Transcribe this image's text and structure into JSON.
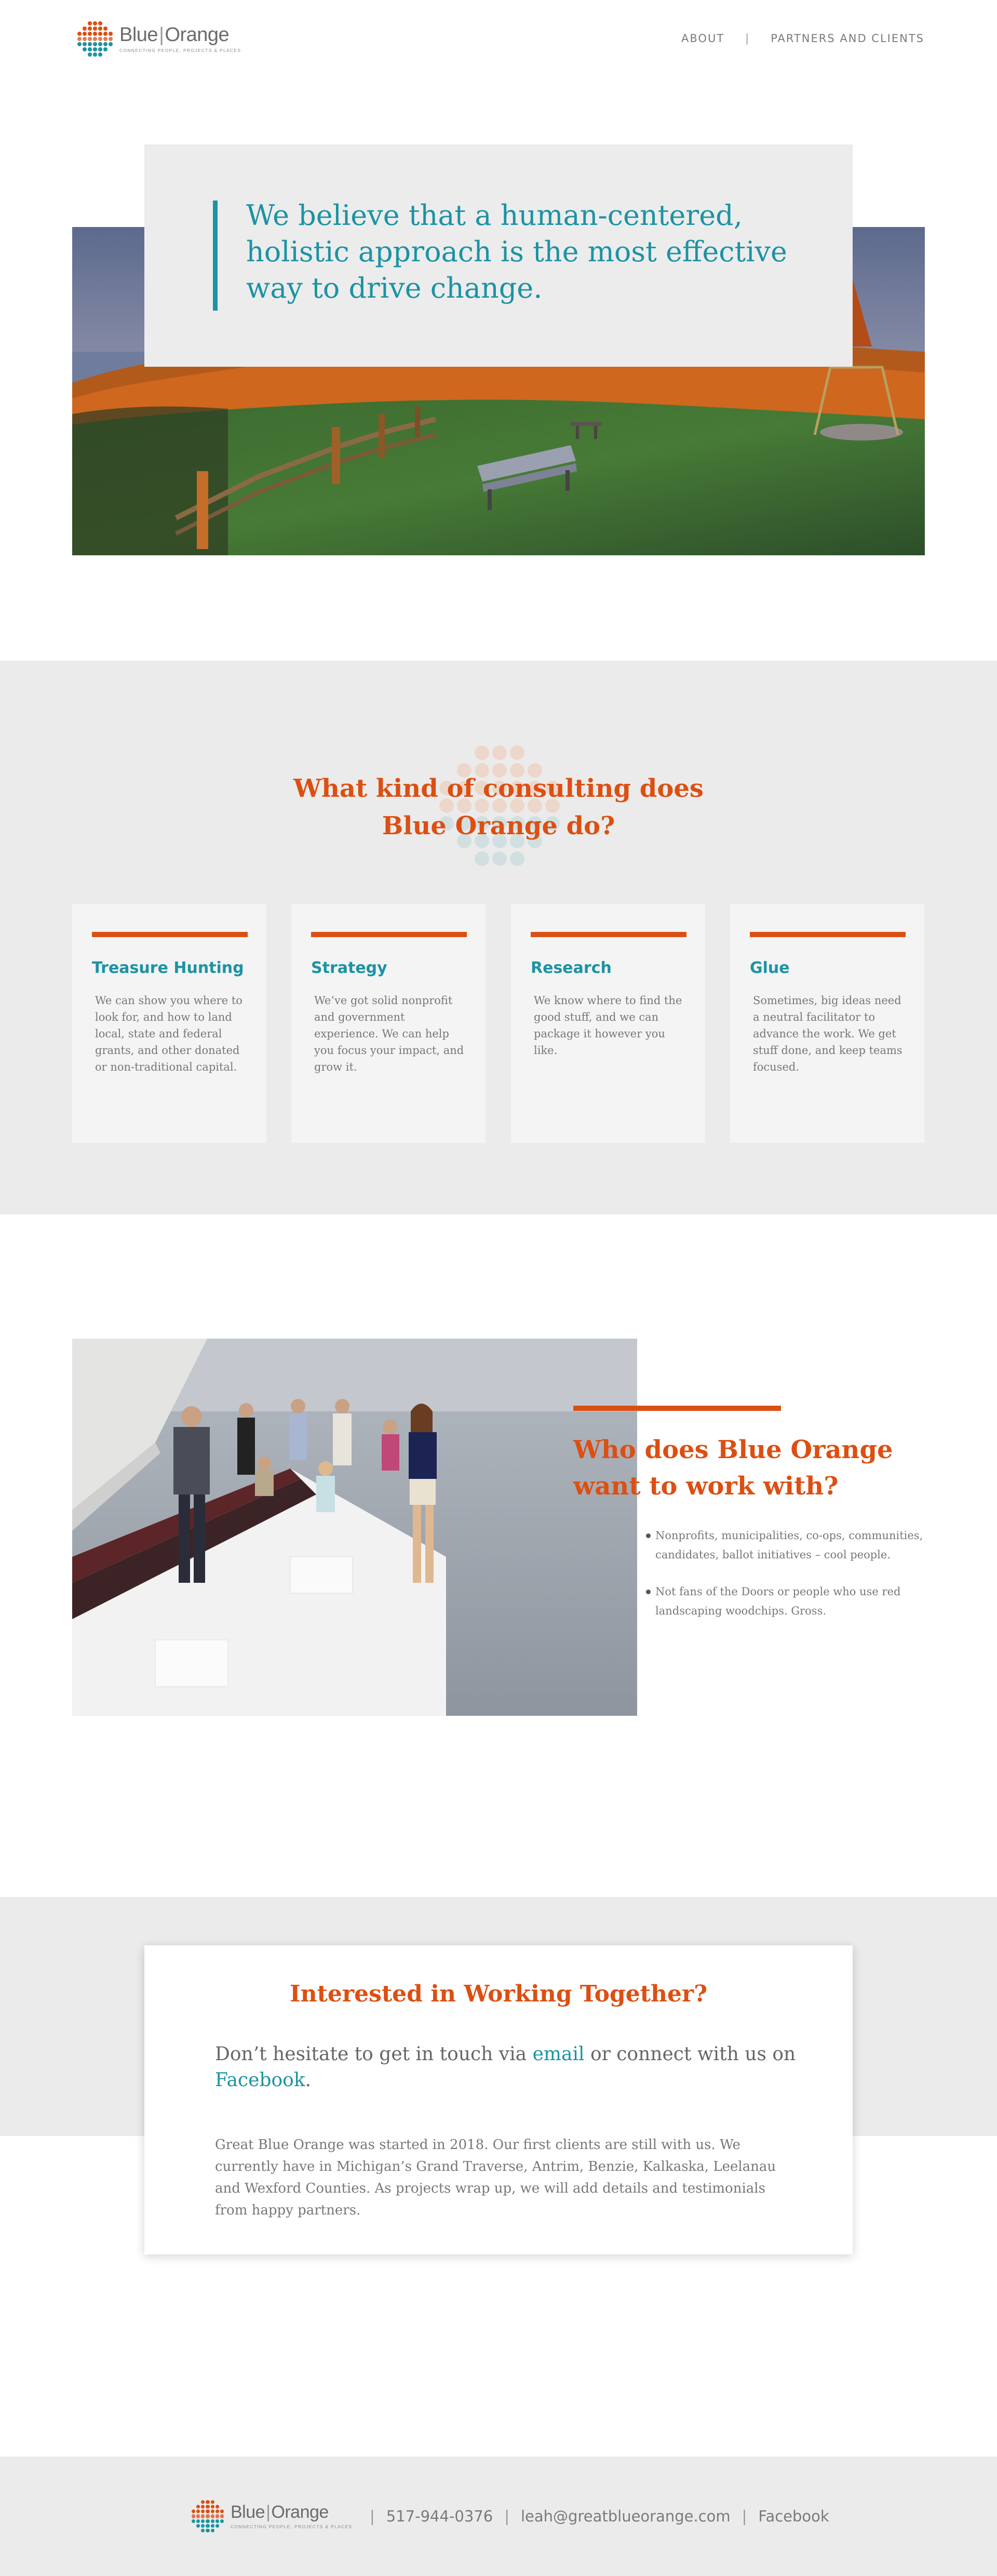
{
  "brand": {
    "name_left": "Blue",
    "separator": "|",
    "name_right": "Orange",
    "tagline": "CONNECTING PEOPLE, PROJECTS & PLACES",
    "colors": {
      "orange": "#dc4f12",
      "teal": "#1b93a4",
      "gray_bg": "#ebebeb"
    },
    "logo_icon": "dot-grid-logo-icon"
  },
  "nav": {
    "items": [
      {
        "label": "ABOUT"
      },
      {
        "label": "PARTNERS AND CLIENTS"
      }
    ],
    "divider": "|"
  },
  "hero": {
    "quote": "We believe that a human-centered, holistic approach is the most effective way to drive change."
  },
  "services": {
    "title": "What kind of consulting does Blue Orange do?",
    "cards": [
      {
        "title": "Treasure Hunting",
        "text": "We can show you where to look for, and how to land local, state and federal grants, and other donated or non-traditional capital."
      },
      {
        "title": "Strategy",
        "text": "We’ve got solid nonprofit and government experience. We can help you focus your impact, and grow it."
      },
      {
        "title": "Research",
        "text": "We know where to find the good stuff, and we can package it however you like."
      },
      {
        "title": "Glue",
        "text": "Sometimes, big ideas need a neutral facilitator to advance the work. We get stuff done, and keep teams focused."
      }
    ]
  },
  "who": {
    "title": "Who does Blue Orange want to work with?",
    "items": [
      "Nonprofits, municipalities, co-ops, communities, candidates, ballot initiatives – cool people.",
      "Not fans of the Doors or people who use red landscaping woodchips. Gross."
    ]
  },
  "contact": {
    "title": "Interested in Working Together?",
    "lead_1": "Don’t hesitate to get in touch via ",
    "email_link": "email",
    "lead_2": " or connect with us on ",
    "facebook_link": "Facebook",
    "lead_3": ".",
    "body": "Great Blue Orange was started in 2018. Our first clients are still with us. We currently have in Michigan’s Grand Traverse, Antrim, Benzie, Kalkaska, Leelanau and Wexford Counties. As projects wrap up, we will add details and testimonials from happy partners."
  },
  "footer": {
    "phone": "517-944-0376",
    "email": "leah@greatblueorange.com",
    "facebook": "Facebook",
    "divider": "|"
  }
}
